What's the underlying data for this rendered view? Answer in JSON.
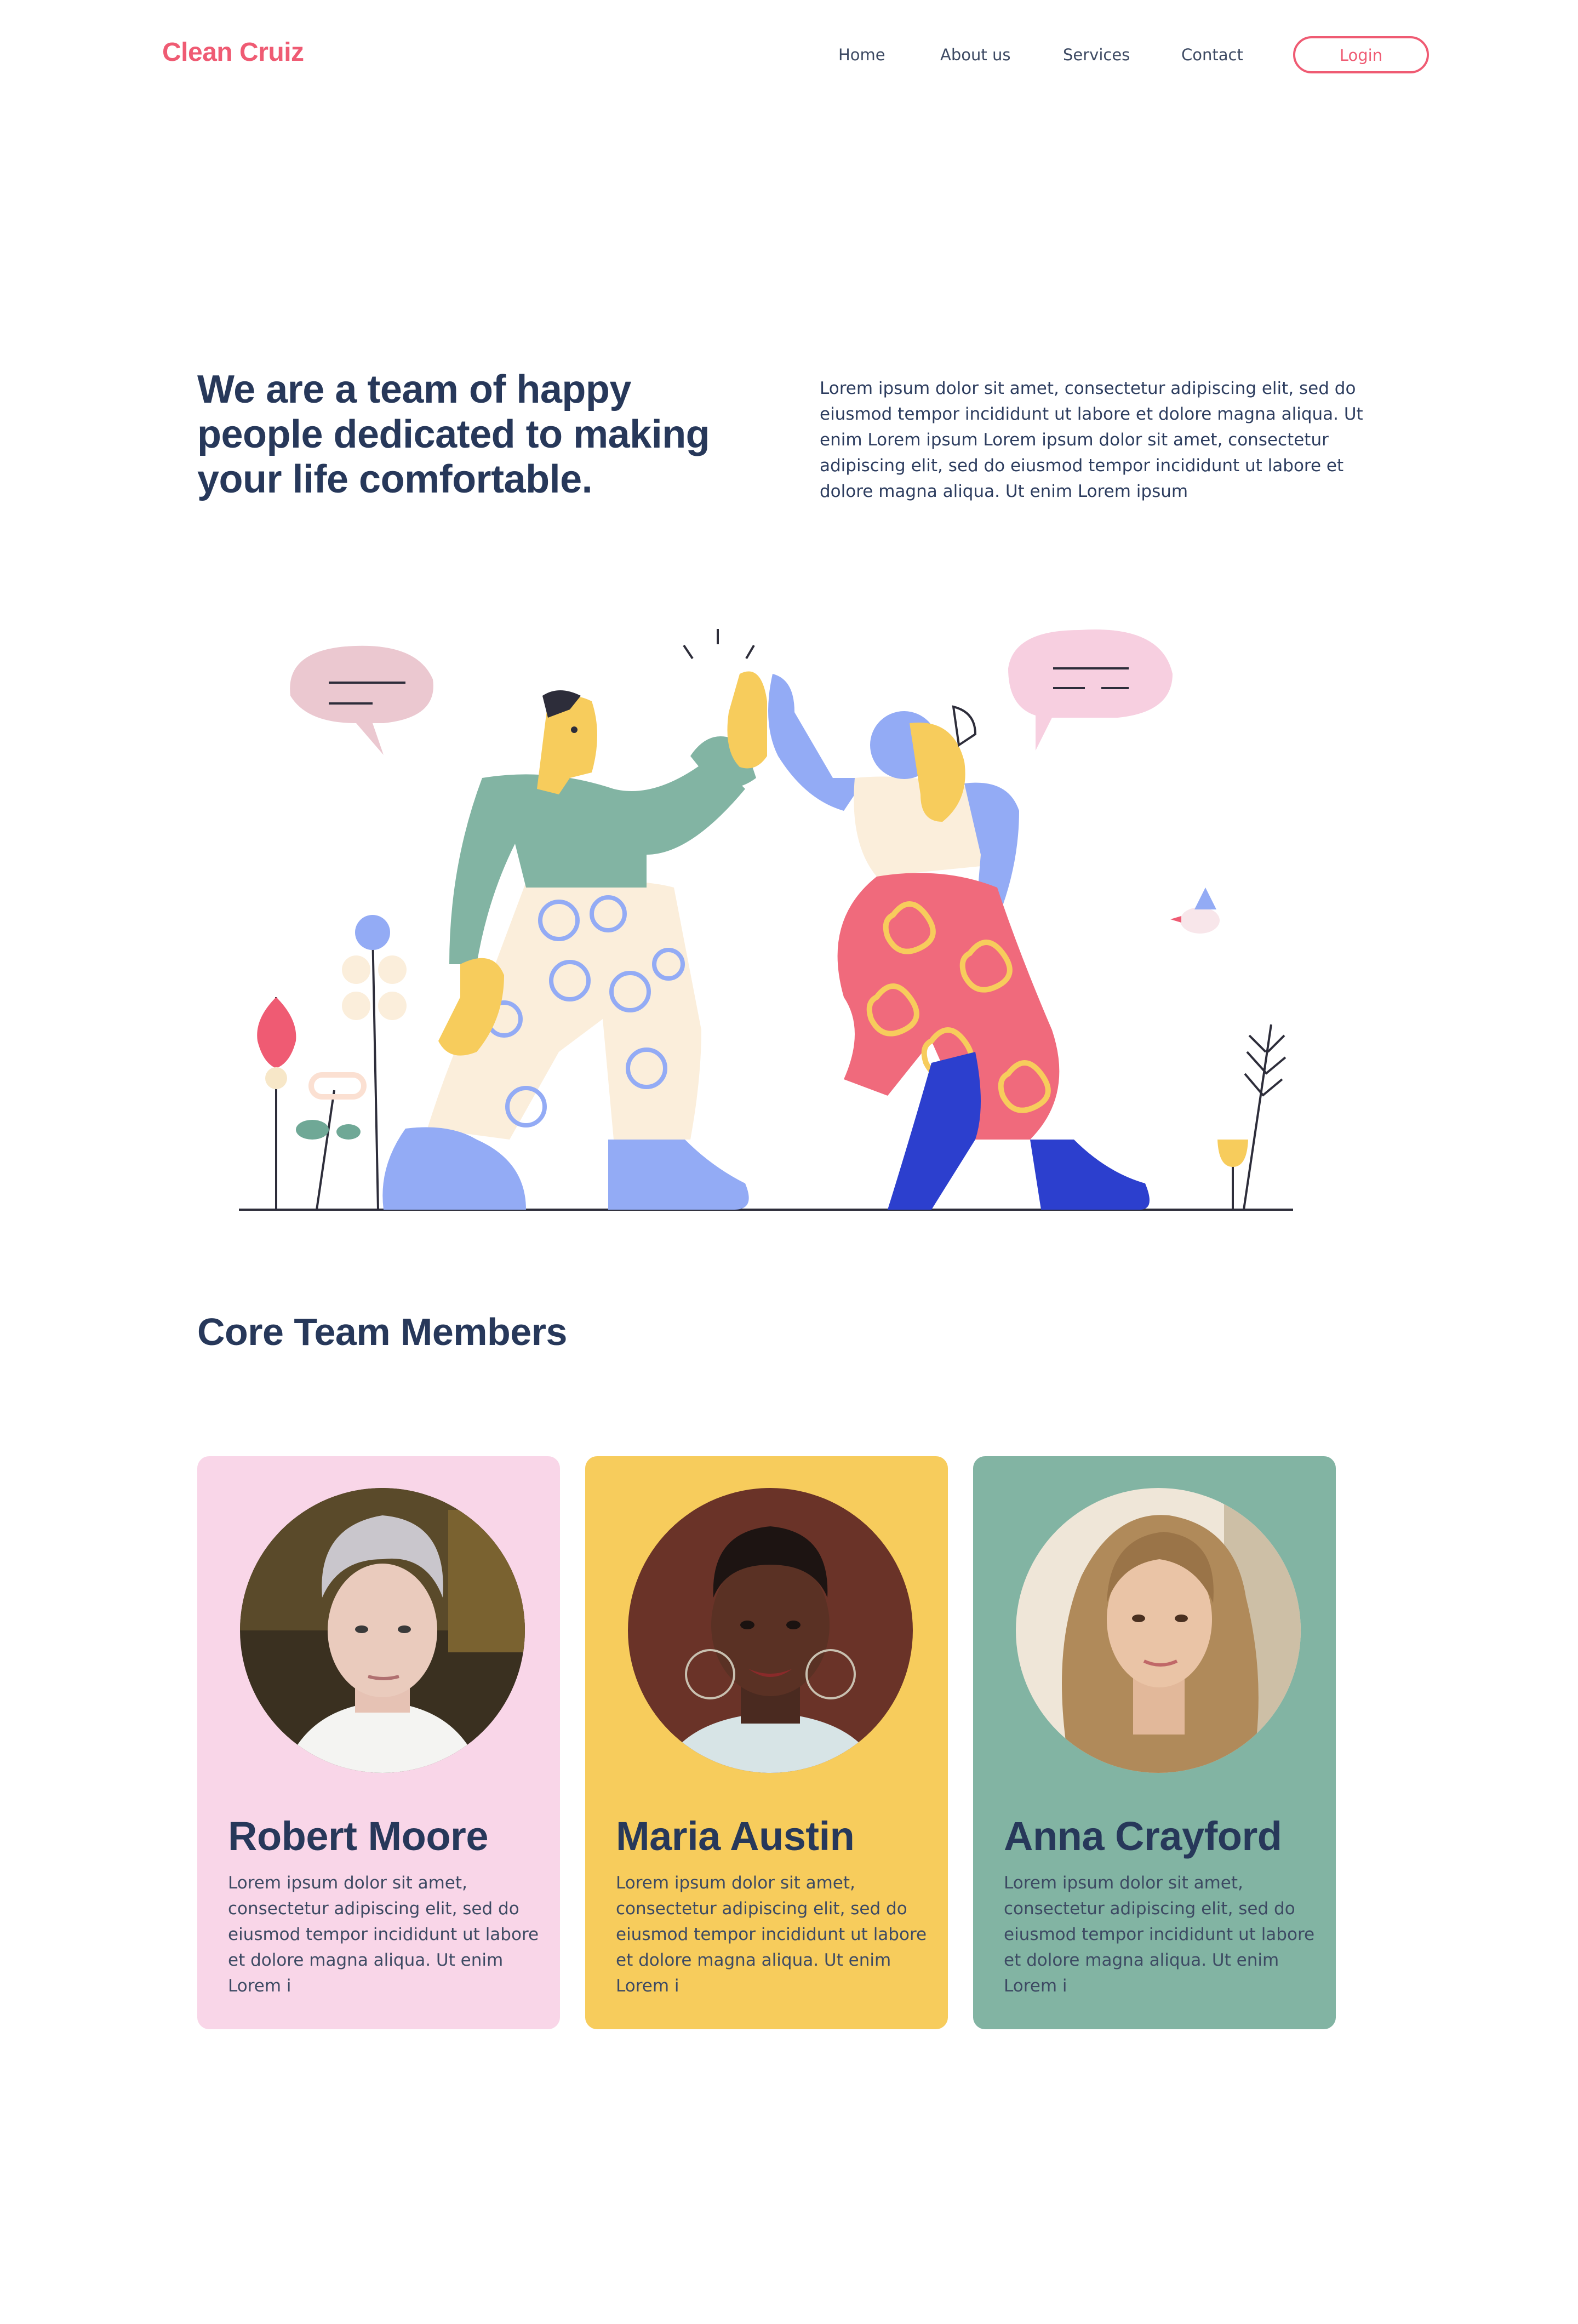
{
  "brand": {
    "logo_text": "Clean Cruiz",
    "accent_color": "#ef5b73",
    "text_color": "#27385a"
  },
  "nav": {
    "items": [
      "Home",
      "About us",
      "Services",
      "Contact"
    ],
    "login_label": "Login"
  },
  "hero": {
    "heading": "We are a team of happy people dedicated to making your life comfortable.",
    "text": "Lorem ipsum dolor sit amet, consectetur adipiscing elit, sed do eiusmod tempor incididunt ut labore et dolore magna aliqua. Ut enim Lorem ipsum Lorem ipsum dolor sit amet, consectetur adipiscing elit, sed do eiusmod tempor incididunt ut labore et dolore magna aliqua. Ut enim Lorem ipsum"
  },
  "team": {
    "title": "Core Team Members",
    "members": [
      {
        "name": "Robert Moore",
        "bio": "Lorem ipsum dolor sit amet, consectetur adipiscing elit, sed do eiusmod tempor incididunt ut labore et dolore magna aliqua. Ut enim Lorem i",
        "card_color": "#f9d6e8"
      },
      {
        "name": "Maria Austin",
        "bio": "Lorem ipsum dolor sit amet, consectetur adipiscing elit, sed do eiusmod tempor incididunt ut labore et dolore magna aliqua. Ut enim Lorem i",
        "card_color": "#f7cc5c"
      },
      {
        "name": "Anna Crayford",
        "bio": "Lorem ipsum dolor sit amet, consectetur adipiscing elit, sed do eiusmod tempor incididunt ut labore et dolore magna aliqua. Ut enim Lorem i",
        "card_color": "#82b4a3"
      }
    ]
  }
}
